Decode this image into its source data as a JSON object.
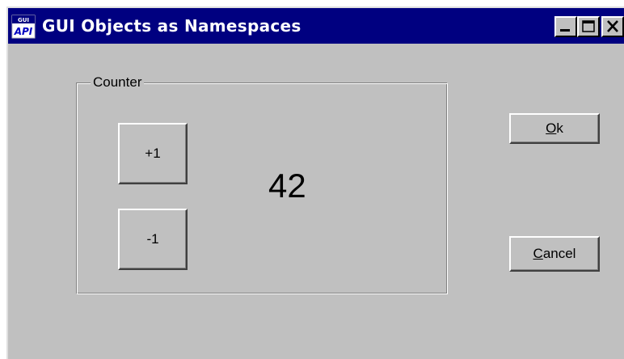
{
  "window": {
    "title": "GUI Objects as Namespaces",
    "app_icon_text_top": "GUI",
    "app_icon_text_bottom": "API",
    "controls": [
      "minimize",
      "maximize",
      "close"
    ]
  },
  "counter_group": {
    "label": "Counter",
    "increment_label": "+1",
    "decrement_label": "-1",
    "value": "42"
  },
  "actions": {
    "ok_mnemonic": "O",
    "ok_rest": "k",
    "cancel_mnemonic": "C",
    "cancel_rest": "ancel"
  },
  "colors": {
    "titlebar": "#000080",
    "face": "#c0c0c0",
    "title_text": "#ffffff"
  }
}
